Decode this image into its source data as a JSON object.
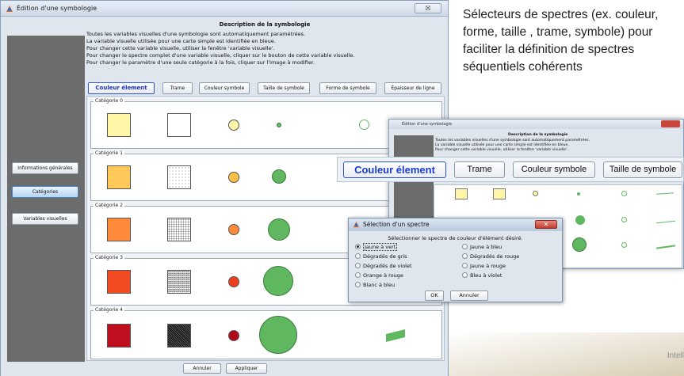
{
  "window": {
    "title": "Édition d'une symbologie",
    "close_label": "☒"
  },
  "description": {
    "title": "Description de la symbologie",
    "lines": [
      "Toutes les variables visuelles d'une symbologie sont automatiquement paramétrées.",
      "La variable visuelle utilisée pour une carte simple est identifiée en bleue.",
      "Pour changer cette variable visuelle, utiliser la fenêtre 'variable visuelle'.",
      "Pour changer le spectre complet d'une variable visuelle, cliquer sur le bouton de cette variable visuelle.",
      "Pour changer le paramètre d'une seule catégorie à la fois, cliquer sur l'image à modifier."
    ]
  },
  "nav": {
    "items": [
      "Informations générales",
      "Catégories",
      "Variables visuelles"
    ],
    "active": "Catégories"
  },
  "tabs": {
    "items": [
      "Couleur élement",
      "Trame",
      "Couleur symbole",
      "Taille de symbole",
      "Forme de symbole",
      "Épaisseur de ligne"
    ],
    "active": "Couleur élement"
  },
  "categories": [
    {
      "label": "Catégorie 0",
      "fill": "#fff6a8",
      "symbol": "#fff6a8",
      "size": 0.1
    },
    {
      "label": "Catégorie 1",
      "fill": "#ffc858",
      "symbol": "#ffc04a",
      "size": 0.3
    },
    {
      "label": "Catégorie 2",
      "fill": "#ff8a3a",
      "symbol": "#ff8a3a",
      "size": 0.55
    },
    {
      "label": "Catégorie 3",
      "fill": "#f24a22",
      "symbol": "#ee3e1e",
      "size": 0.8
    },
    {
      "label": "Catégorie 4",
      "fill": "#c01020",
      "symbol": "#b00a1a",
      "size": 1.0
    }
  ],
  "footer": {
    "cancel": "Annuler",
    "apply": "Appliquer"
  },
  "caption": "Sélecteurs de spectres (ex. couleur, forme, taille , trame, symbole) pour faciliter la définition de spectres séquentiels cohérents",
  "zoom": {
    "title": "Édition d'une symbologie",
    "desc_title": "Description de la symbologie",
    "lines": [
      "Toutes les variables visuelles d'une symbologie sont automatiquement paramétrées.",
      "La variable visuelle utilisée pour une carte simple est identifiée en bleue.",
      "Pour changer cette variable visuelle, utiliser la fenêtre 'variable visuelle'."
    ],
    "buttons": [
      "Couleur élement",
      "Trame",
      "Couleur symbole",
      "Taille de symbole"
    ]
  },
  "dialog": {
    "title": "Sélection d'un spectre",
    "close_label": "✕",
    "instruction": "Sélectionner le spectre de couleur d'élément désiré.",
    "options_left": [
      "Jaune à vert",
      "Dégradés de gris",
      "Dégradés de violet",
      "Orange à rouge",
      "Blanc à bleu"
    ],
    "options_right": [
      "Jaune à bleu",
      "Dégradés de rouge",
      "Jaune à rouge",
      "Bleu à violet"
    ],
    "selected": "Jaune à vert",
    "ok": "OK",
    "cancel": "Annuler"
  },
  "watermark": "Intell"
}
